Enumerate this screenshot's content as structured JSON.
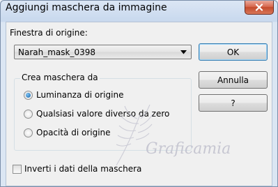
{
  "window": {
    "title": "Aggiungi maschera da immagine"
  },
  "source": {
    "label": "Finestra di origine:",
    "selected": "Narah_mask_0398"
  },
  "buttons": {
    "ok": "OK",
    "cancel": "Annulla",
    "help": "?"
  },
  "mask_group": {
    "legend": "Crea maschera da",
    "options": [
      {
        "label": "Luminanza di origine",
        "checked": true
      },
      {
        "label": "Qualsiasi valore diverso da zero",
        "checked": false
      },
      {
        "label": "Opacità di origine",
        "checked": false
      }
    ]
  },
  "invert": {
    "label": "Inverti i dati della maschera",
    "checked": false
  },
  "watermark": {
    "text": "Graficamia"
  },
  "colors": {
    "close_button": "#c44a2c",
    "default_button_border": "#3c7fb1",
    "selected_radio": "#1562a8"
  }
}
